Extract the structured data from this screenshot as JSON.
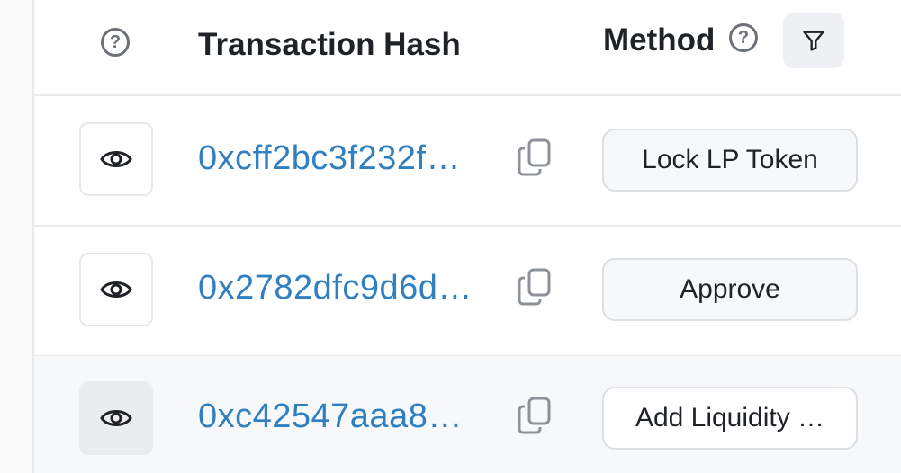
{
  "header": {
    "hash_label": "Transaction Hash",
    "method_label": "Method",
    "help_glyph": "?"
  },
  "rows": [
    {
      "hash": "0xcff2bc3f232f…",
      "method": "Lock LP Token"
    },
    {
      "hash": "0x2782dfc9d6d…",
      "method": "Approve"
    },
    {
      "hash": "0xc42547aaa8…",
      "method": "Add Liquidity …"
    }
  ],
  "colors": {
    "link": "#2f7fc1",
    "header_text": "#1f2328",
    "icon": "#6c7178",
    "border": "#e9eaec"
  },
  "icons": {
    "row_view": "eye-icon",
    "copy": "copy-icon",
    "help": "help-circle-icon",
    "filter": "filter-icon"
  }
}
